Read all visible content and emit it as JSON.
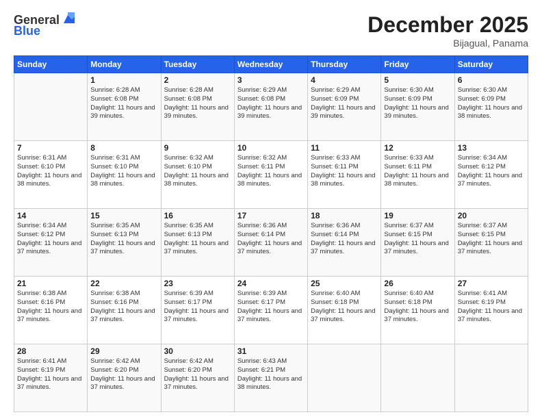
{
  "header": {
    "logo_general": "General",
    "logo_blue": "Blue",
    "month_title": "December 2025",
    "location": "Bijagual, Panama"
  },
  "days_of_week": [
    "Sunday",
    "Monday",
    "Tuesday",
    "Wednesday",
    "Thursday",
    "Friday",
    "Saturday"
  ],
  "weeks": [
    [
      {
        "day": "",
        "sunrise": "",
        "sunset": "",
        "daylight": ""
      },
      {
        "day": "1",
        "sunrise": "Sunrise: 6:28 AM",
        "sunset": "Sunset: 6:08 PM",
        "daylight": "Daylight: 11 hours and 39 minutes."
      },
      {
        "day": "2",
        "sunrise": "Sunrise: 6:28 AM",
        "sunset": "Sunset: 6:08 PM",
        "daylight": "Daylight: 11 hours and 39 minutes."
      },
      {
        "day": "3",
        "sunrise": "Sunrise: 6:29 AM",
        "sunset": "Sunset: 6:08 PM",
        "daylight": "Daylight: 11 hours and 39 minutes."
      },
      {
        "day": "4",
        "sunrise": "Sunrise: 6:29 AM",
        "sunset": "Sunset: 6:09 PM",
        "daylight": "Daylight: 11 hours and 39 minutes."
      },
      {
        "day": "5",
        "sunrise": "Sunrise: 6:30 AM",
        "sunset": "Sunset: 6:09 PM",
        "daylight": "Daylight: 11 hours and 39 minutes."
      },
      {
        "day": "6",
        "sunrise": "Sunrise: 6:30 AM",
        "sunset": "Sunset: 6:09 PM",
        "daylight": "Daylight: 11 hours and 38 minutes."
      }
    ],
    [
      {
        "day": "7",
        "sunrise": "Sunrise: 6:31 AM",
        "sunset": "Sunset: 6:10 PM",
        "daylight": "Daylight: 11 hours and 38 minutes."
      },
      {
        "day": "8",
        "sunrise": "Sunrise: 6:31 AM",
        "sunset": "Sunset: 6:10 PM",
        "daylight": "Daylight: 11 hours and 38 minutes."
      },
      {
        "day": "9",
        "sunrise": "Sunrise: 6:32 AM",
        "sunset": "Sunset: 6:10 PM",
        "daylight": "Daylight: 11 hours and 38 minutes."
      },
      {
        "day": "10",
        "sunrise": "Sunrise: 6:32 AM",
        "sunset": "Sunset: 6:11 PM",
        "daylight": "Daylight: 11 hours and 38 minutes."
      },
      {
        "day": "11",
        "sunrise": "Sunrise: 6:33 AM",
        "sunset": "Sunset: 6:11 PM",
        "daylight": "Daylight: 11 hours and 38 minutes."
      },
      {
        "day": "12",
        "sunrise": "Sunrise: 6:33 AM",
        "sunset": "Sunset: 6:11 PM",
        "daylight": "Daylight: 11 hours and 38 minutes."
      },
      {
        "day": "13",
        "sunrise": "Sunrise: 6:34 AM",
        "sunset": "Sunset: 6:12 PM",
        "daylight": "Daylight: 11 hours and 37 minutes."
      }
    ],
    [
      {
        "day": "14",
        "sunrise": "Sunrise: 6:34 AM",
        "sunset": "Sunset: 6:12 PM",
        "daylight": "Daylight: 11 hours and 37 minutes."
      },
      {
        "day": "15",
        "sunrise": "Sunrise: 6:35 AM",
        "sunset": "Sunset: 6:13 PM",
        "daylight": "Daylight: 11 hours and 37 minutes."
      },
      {
        "day": "16",
        "sunrise": "Sunrise: 6:35 AM",
        "sunset": "Sunset: 6:13 PM",
        "daylight": "Daylight: 11 hours and 37 minutes."
      },
      {
        "day": "17",
        "sunrise": "Sunrise: 6:36 AM",
        "sunset": "Sunset: 6:14 PM",
        "daylight": "Daylight: 11 hours and 37 minutes."
      },
      {
        "day": "18",
        "sunrise": "Sunrise: 6:36 AM",
        "sunset": "Sunset: 6:14 PM",
        "daylight": "Daylight: 11 hours and 37 minutes."
      },
      {
        "day": "19",
        "sunrise": "Sunrise: 6:37 AM",
        "sunset": "Sunset: 6:15 PM",
        "daylight": "Daylight: 11 hours and 37 minutes."
      },
      {
        "day": "20",
        "sunrise": "Sunrise: 6:37 AM",
        "sunset": "Sunset: 6:15 PM",
        "daylight": "Daylight: 11 hours and 37 minutes."
      }
    ],
    [
      {
        "day": "21",
        "sunrise": "Sunrise: 6:38 AM",
        "sunset": "Sunset: 6:16 PM",
        "daylight": "Daylight: 11 hours and 37 minutes."
      },
      {
        "day": "22",
        "sunrise": "Sunrise: 6:38 AM",
        "sunset": "Sunset: 6:16 PM",
        "daylight": "Daylight: 11 hours and 37 minutes."
      },
      {
        "day": "23",
        "sunrise": "Sunrise: 6:39 AM",
        "sunset": "Sunset: 6:17 PM",
        "daylight": "Daylight: 11 hours and 37 minutes."
      },
      {
        "day": "24",
        "sunrise": "Sunrise: 6:39 AM",
        "sunset": "Sunset: 6:17 PM",
        "daylight": "Daylight: 11 hours and 37 minutes."
      },
      {
        "day": "25",
        "sunrise": "Sunrise: 6:40 AM",
        "sunset": "Sunset: 6:18 PM",
        "daylight": "Daylight: 11 hours and 37 minutes."
      },
      {
        "day": "26",
        "sunrise": "Sunrise: 6:40 AM",
        "sunset": "Sunset: 6:18 PM",
        "daylight": "Daylight: 11 hours and 37 minutes."
      },
      {
        "day": "27",
        "sunrise": "Sunrise: 6:41 AM",
        "sunset": "Sunset: 6:19 PM",
        "daylight": "Daylight: 11 hours and 37 minutes."
      }
    ],
    [
      {
        "day": "28",
        "sunrise": "Sunrise: 6:41 AM",
        "sunset": "Sunset: 6:19 PM",
        "daylight": "Daylight: 11 hours and 37 minutes."
      },
      {
        "day": "29",
        "sunrise": "Sunrise: 6:42 AM",
        "sunset": "Sunset: 6:20 PM",
        "daylight": "Daylight: 11 hours and 37 minutes."
      },
      {
        "day": "30",
        "sunrise": "Sunrise: 6:42 AM",
        "sunset": "Sunset: 6:20 PM",
        "daylight": "Daylight: 11 hours and 37 minutes."
      },
      {
        "day": "31",
        "sunrise": "Sunrise: 6:43 AM",
        "sunset": "Sunset: 6:21 PM",
        "daylight": "Daylight: 11 hours and 38 minutes."
      },
      {
        "day": "",
        "sunrise": "",
        "sunset": "",
        "daylight": ""
      },
      {
        "day": "",
        "sunrise": "",
        "sunset": "",
        "daylight": ""
      },
      {
        "day": "",
        "sunrise": "",
        "sunset": "",
        "daylight": ""
      }
    ]
  ]
}
